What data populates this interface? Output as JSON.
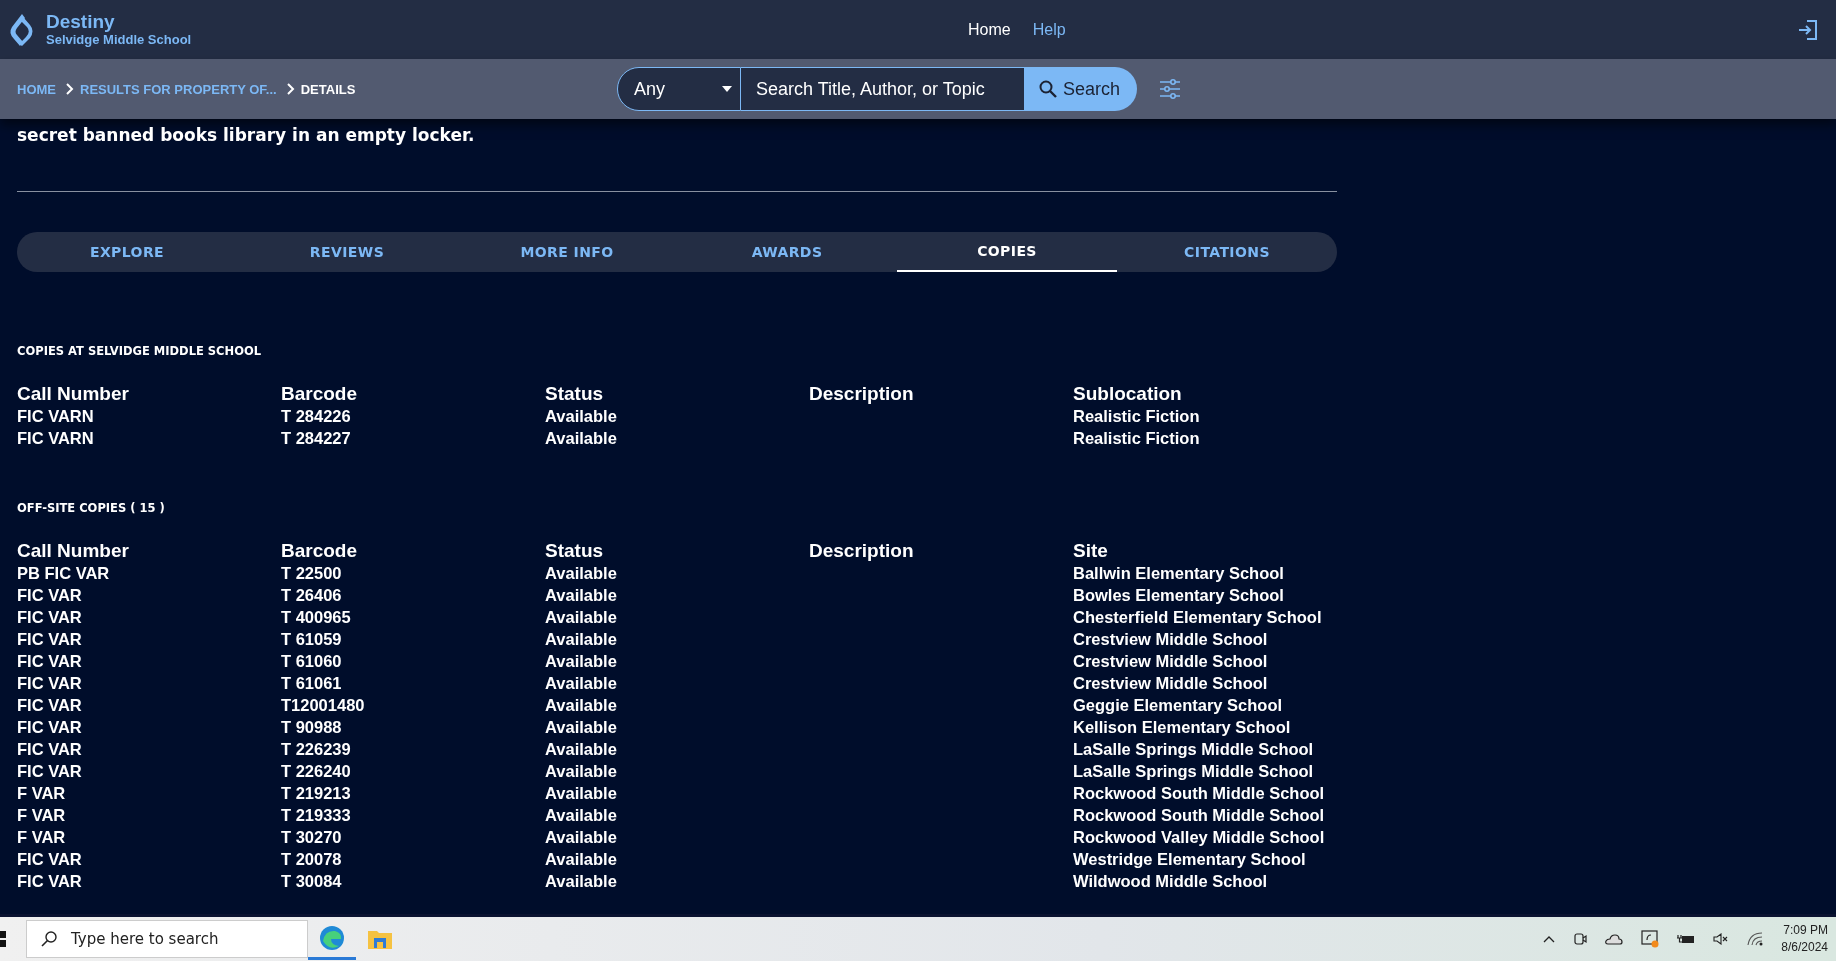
{
  "header": {
    "app_name": "Destiny",
    "school": "Selvidge Middle School",
    "nav": [
      {
        "label": "Home",
        "selected": true
      },
      {
        "label": "Help",
        "selected": false
      }
    ]
  },
  "breadcrumb": [
    {
      "label": "HOME",
      "current": false
    },
    {
      "label": "RESULTS FOR PROPERTY OF...",
      "current": false
    },
    {
      "label": "DETAILS",
      "current": true
    }
  ],
  "search": {
    "scope": "Any",
    "placeholder": "Search Title, Author, or Topic",
    "button": "Search"
  },
  "summary_tail": "secret banned books library in an empty locker.",
  "tabs": [
    {
      "label": "EXPLORE",
      "selected": false
    },
    {
      "label": "REVIEWS",
      "selected": false
    },
    {
      "label": "MORE INFO",
      "selected": false
    },
    {
      "label": "AWARDS",
      "selected": false
    },
    {
      "label": "COPIES",
      "selected": true
    },
    {
      "label": "CITATIONS",
      "selected": false
    }
  ],
  "sections": [
    {
      "title": "COPIES AT SELVIDGE MIDDLE SCHOOL",
      "columns": [
        "Call Number",
        "Barcode",
        "Status",
        "Description",
        "Sublocation"
      ],
      "rows": [
        [
          "FIC VARN",
          "T 284226",
          "Available",
          "",
          "Realistic Fiction"
        ],
        [
          "FIC VARN",
          "T 284227",
          "Available",
          "",
          "Realistic Fiction"
        ]
      ]
    },
    {
      "title": "OFF-SITE COPIES ( 15 )",
      "columns": [
        "Call Number",
        "Barcode",
        "Status",
        "Description",
        "Site"
      ],
      "rows": [
        [
          "PB FIC VAR",
          "T 22500",
          "Available",
          "",
          "Ballwin Elementary School"
        ],
        [
          "FIC VAR",
          "T 26406",
          "Available",
          "",
          "Bowles Elementary School"
        ],
        [
          "FIC VAR",
          "T 400965",
          "Available",
          "",
          "Chesterfield Elementary School"
        ],
        [
          "FIC VAR",
          "T 61059",
          "Available",
          "",
          "Crestview Middle School"
        ],
        [
          "FIC VAR",
          "T 61060",
          "Available",
          "",
          "Crestview Middle School"
        ],
        [
          "FIC VAR",
          "T 61061",
          "Available",
          "",
          "Crestview Middle School"
        ],
        [
          "FIC VAR",
          "T12001480",
          "Available",
          "",
          "Geggie Elementary School"
        ],
        [
          "FIC VAR",
          "T 90988",
          "Available",
          "",
          "Kellison Elementary School"
        ],
        [
          "FIC VAR",
          "T 226239",
          "Available",
          "",
          "LaSalle Springs Middle School"
        ],
        [
          "FIC VAR",
          "T 226240",
          "Available",
          "",
          "LaSalle Springs Middle School"
        ],
        [
          "F VAR",
          "T 219213",
          "Available",
          "",
          "Rockwood South Middle School"
        ],
        [
          "F VAR",
          "T 219333",
          "Available",
          "",
          "Rockwood South Middle School"
        ],
        [
          "F VAR",
          "T 30270",
          "Available",
          "",
          "Rockwood Valley Middle School"
        ],
        [
          "FIC VAR",
          "T 20078",
          "Available",
          "",
          "Westridge Elementary School"
        ],
        [
          "FIC VAR",
          "T 30084",
          "Available",
          "",
          "Wildwood Middle School"
        ]
      ]
    }
  ],
  "taskbar": {
    "search_placeholder": "Type here to search",
    "time": "7:09 PM",
    "date": "8/6/2024"
  }
}
